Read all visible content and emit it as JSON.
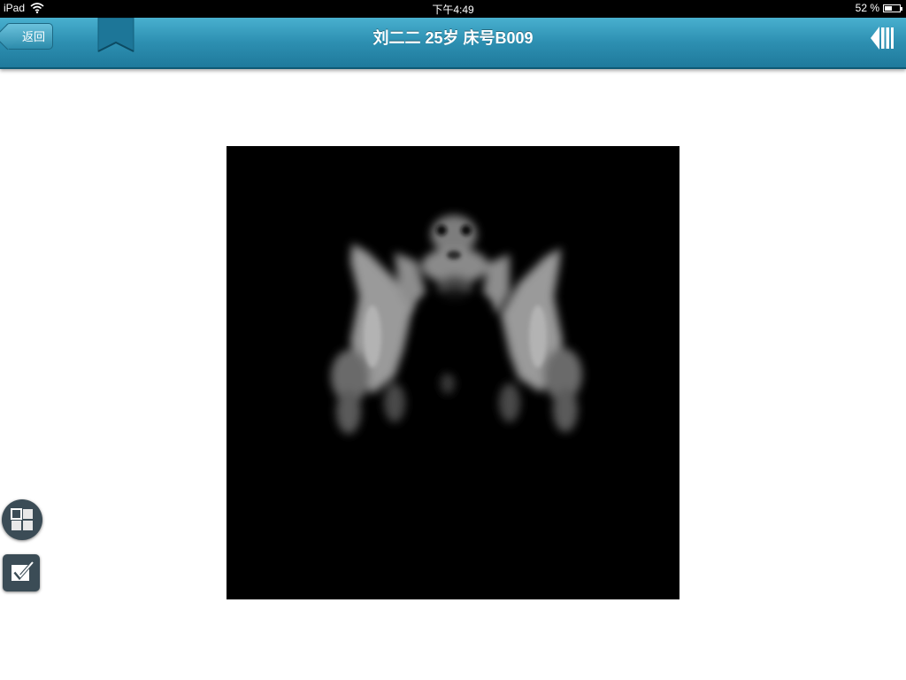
{
  "status_bar": {
    "device": "iPad",
    "time": "下午4:49",
    "battery_percent": "52 %",
    "battery_level": 0.52
  },
  "nav": {
    "back_label": "返回",
    "title": "刘二二 25岁 床号B009"
  },
  "icons": {
    "bookmark": "bookmark-icon",
    "collapse": "collapse-panel-icon",
    "grid": "grid-layout-icon",
    "check": "checkbox-edit-icon",
    "wifi": "wifi-icon",
    "battery": "battery-icon"
  },
  "colors": {
    "nav_bar": "#2d8fb1",
    "tool_button": "#3b4c56",
    "image_background": "#000000"
  }
}
